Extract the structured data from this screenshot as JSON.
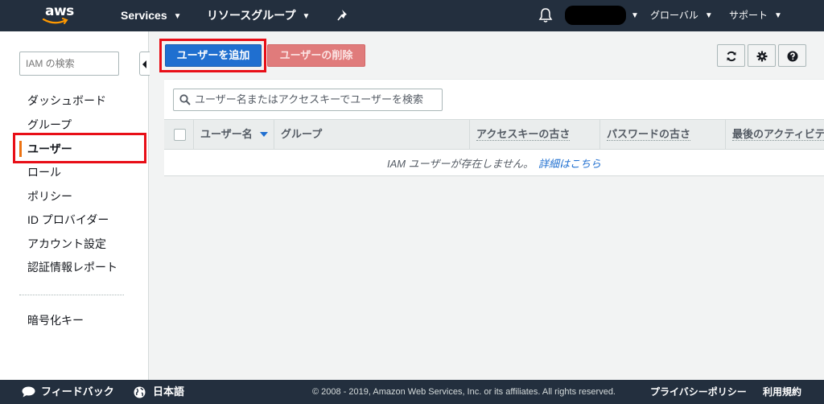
{
  "topnav": {
    "logo_text": "aws",
    "services_label": "Services",
    "resource_groups_label": "リソースグループ",
    "region_label": "グローバル",
    "support_label": "サポート"
  },
  "sidebar": {
    "search_placeholder": "IAM の検索",
    "items": [
      {
        "label": "ダッシュボード"
      },
      {
        "label": "グループ"
      },
      {
        "label": "ユーザー",
        "active": true
      },
      {
        "label": "ロール"
      },
      {
        "label": "ポリシー"
      },
      {
        "label": "ID プロバイダー"
      },
      {
        "label": "アカウント設定"
      },
      {
        "label": "認証情報レポート"
      }
    ],
    "secondary_items": [
      {
        "label": "暗号化キー"
      }
    ]
  },
  "toolbar": {
    "add_user_label": "ユーザーを追加",
    "delete_user_label": "ユーザーの削除"
  },
  "table": {
    "search_placeholder": "ユーザー名またはアクセスキーでユーザーを検索",
    "columns": [
      "ユーザー名",
      "グループ",
      "アクセスキーの古さ",
      "パスワードの古さ",
      "最後のアクティビティ"
    ],
    "empty_message": "IAM ユーザーが存在しません。",
    "empty_link": "詳細はこちら"
  },
  "footer": {
    "feedback_label": "フィードバック",
    "language_label": "日本語",
    "copyright": "© 2008 - 2019, Amazon Web Services, Inc. or its affiliates. All rights reserved.",
    "privacy_label": "プライバシーポリシー",
    "terms_label": "利用規約"
  },
  "colors": {
    "nav_bg": "#232f3e",
    "primary": "#1f6fd0",
    "danger": "#e07b7b",
    "active_marker": "#ec7211",
    "highlight": "#e80e17"
  }
}
